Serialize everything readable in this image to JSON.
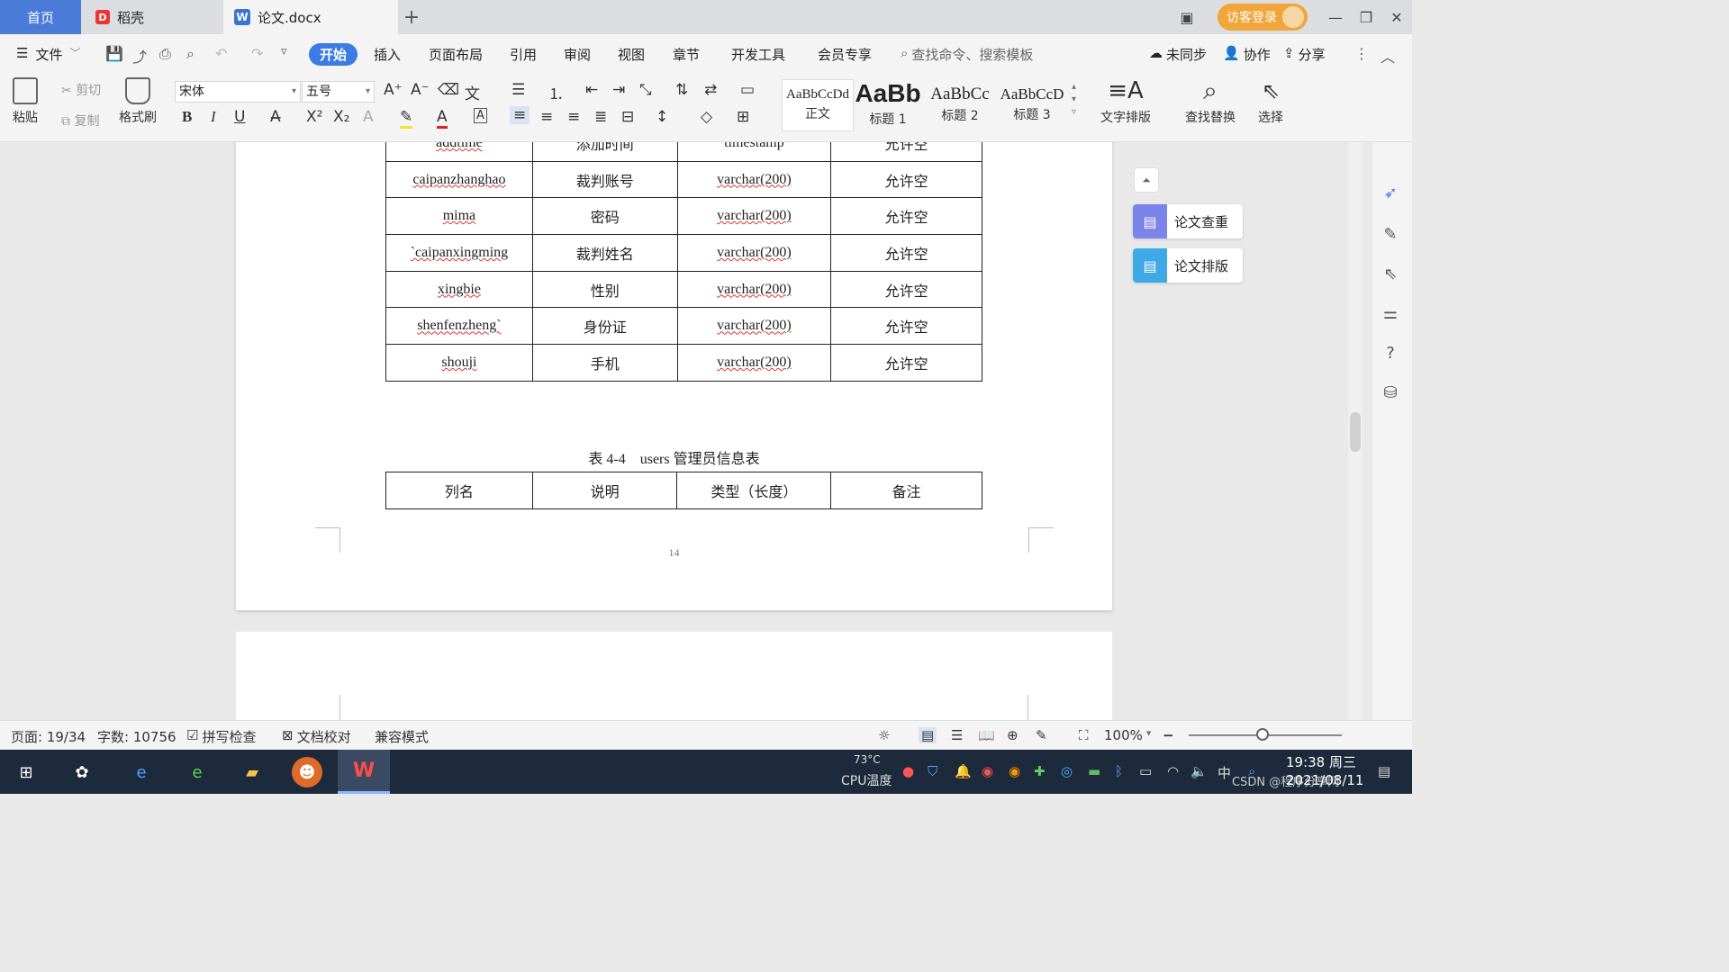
{
  "tabs": {
    "home": "首页",
    "daoke": "稻壳",
    "doc": "论文.docx",
    "add": "+"
  },
  "account": {
    "visitor_login": "访客登录"
  },
  "menubar": {
    "file": "文件",
    "start": "开始",
    "items": [
      "插入",
      "页面布局",
      "引用",
      "审阅",
      "视图",
      "章节",
      "开发工具",
      "会员专享"
    ],
    "search_placeholder": "查找命令、搜索模板",
    "unsynced": "未同步",
    "collab": "协作",
    "share": "分享"
  },
  "ribbon": {
    "paste": "粘贴",
    "cut": "剪切",
    "copy": "复制",
    "format_painter": "格式刷",
    "font_name": "宋体",
    "font_size": "五号",
    "styles": [
      {
        "preview": "AaBbCcDd",
        "name": "正文"
      },
      {
        "preview": "AaBb",
        "name": "标题 1"
      },
      {
        "preview": "AaBbCc",
        "name": "标题 2"
      },
      {
        "preview": "AaBbCcD",
        "name": "标题 3"
      }
    ],
    "text_layout": "文字排版",
    "find_replace": "查找替换",
    "select": "选择"
  },
  "document": {
    "table1_rows": [
      [
        "addtime",
        "添加时间",
        "timestamp",
        "允许空"
      ],
      [
        "caipanzhanghao",
        "裁判账号",
        "varchar(200)",
        "允许空"
      ],
      [
        "mima",
        "密码",
        "varchar(200)",
        "允许空"
      ],
      [
        "`caipanxingming",
        "裁判姓名",
        "varchar(200)",
        "允许空"
      ],
      [
        "xingbie",
        "性别",
        "varchar(200)",
        "允许空"
      ],
      [
        "shenfenzheng`",
        "身份证",
        "varchar(200)",
        "允许空"
      ],
      [
        "shouji",
        "手机",
        "varchar(200)",
        "允许空"
      ]
    ],
    "caption": "表 4-4　users 管理员信息表",
    "table2_header": [
      "列名",
      "说明",
      "类型（长度）",
      "备注"
    ],
    "page_number": "14"
  },
  "side_panel": {
    "check": "论文查重",
    "layout": "论文排版"
  },
  "statusbar": {
    "page": "页面: 19/34",
    "words": "字数: 10756",
    "spell": "拼写检查",
    "proof": "文档校对",
    "compat": "兼容模式",
    "zoom": "100%"
  },
  "taskbar": {
    "temp": "73°C",
    "cpu": "CPU温度",
    "ime": "中",
    "time": "19:38 周三",
    "date": "2021/08/11",
    "watermark": "CSDN @程序分享网"
  }
}
